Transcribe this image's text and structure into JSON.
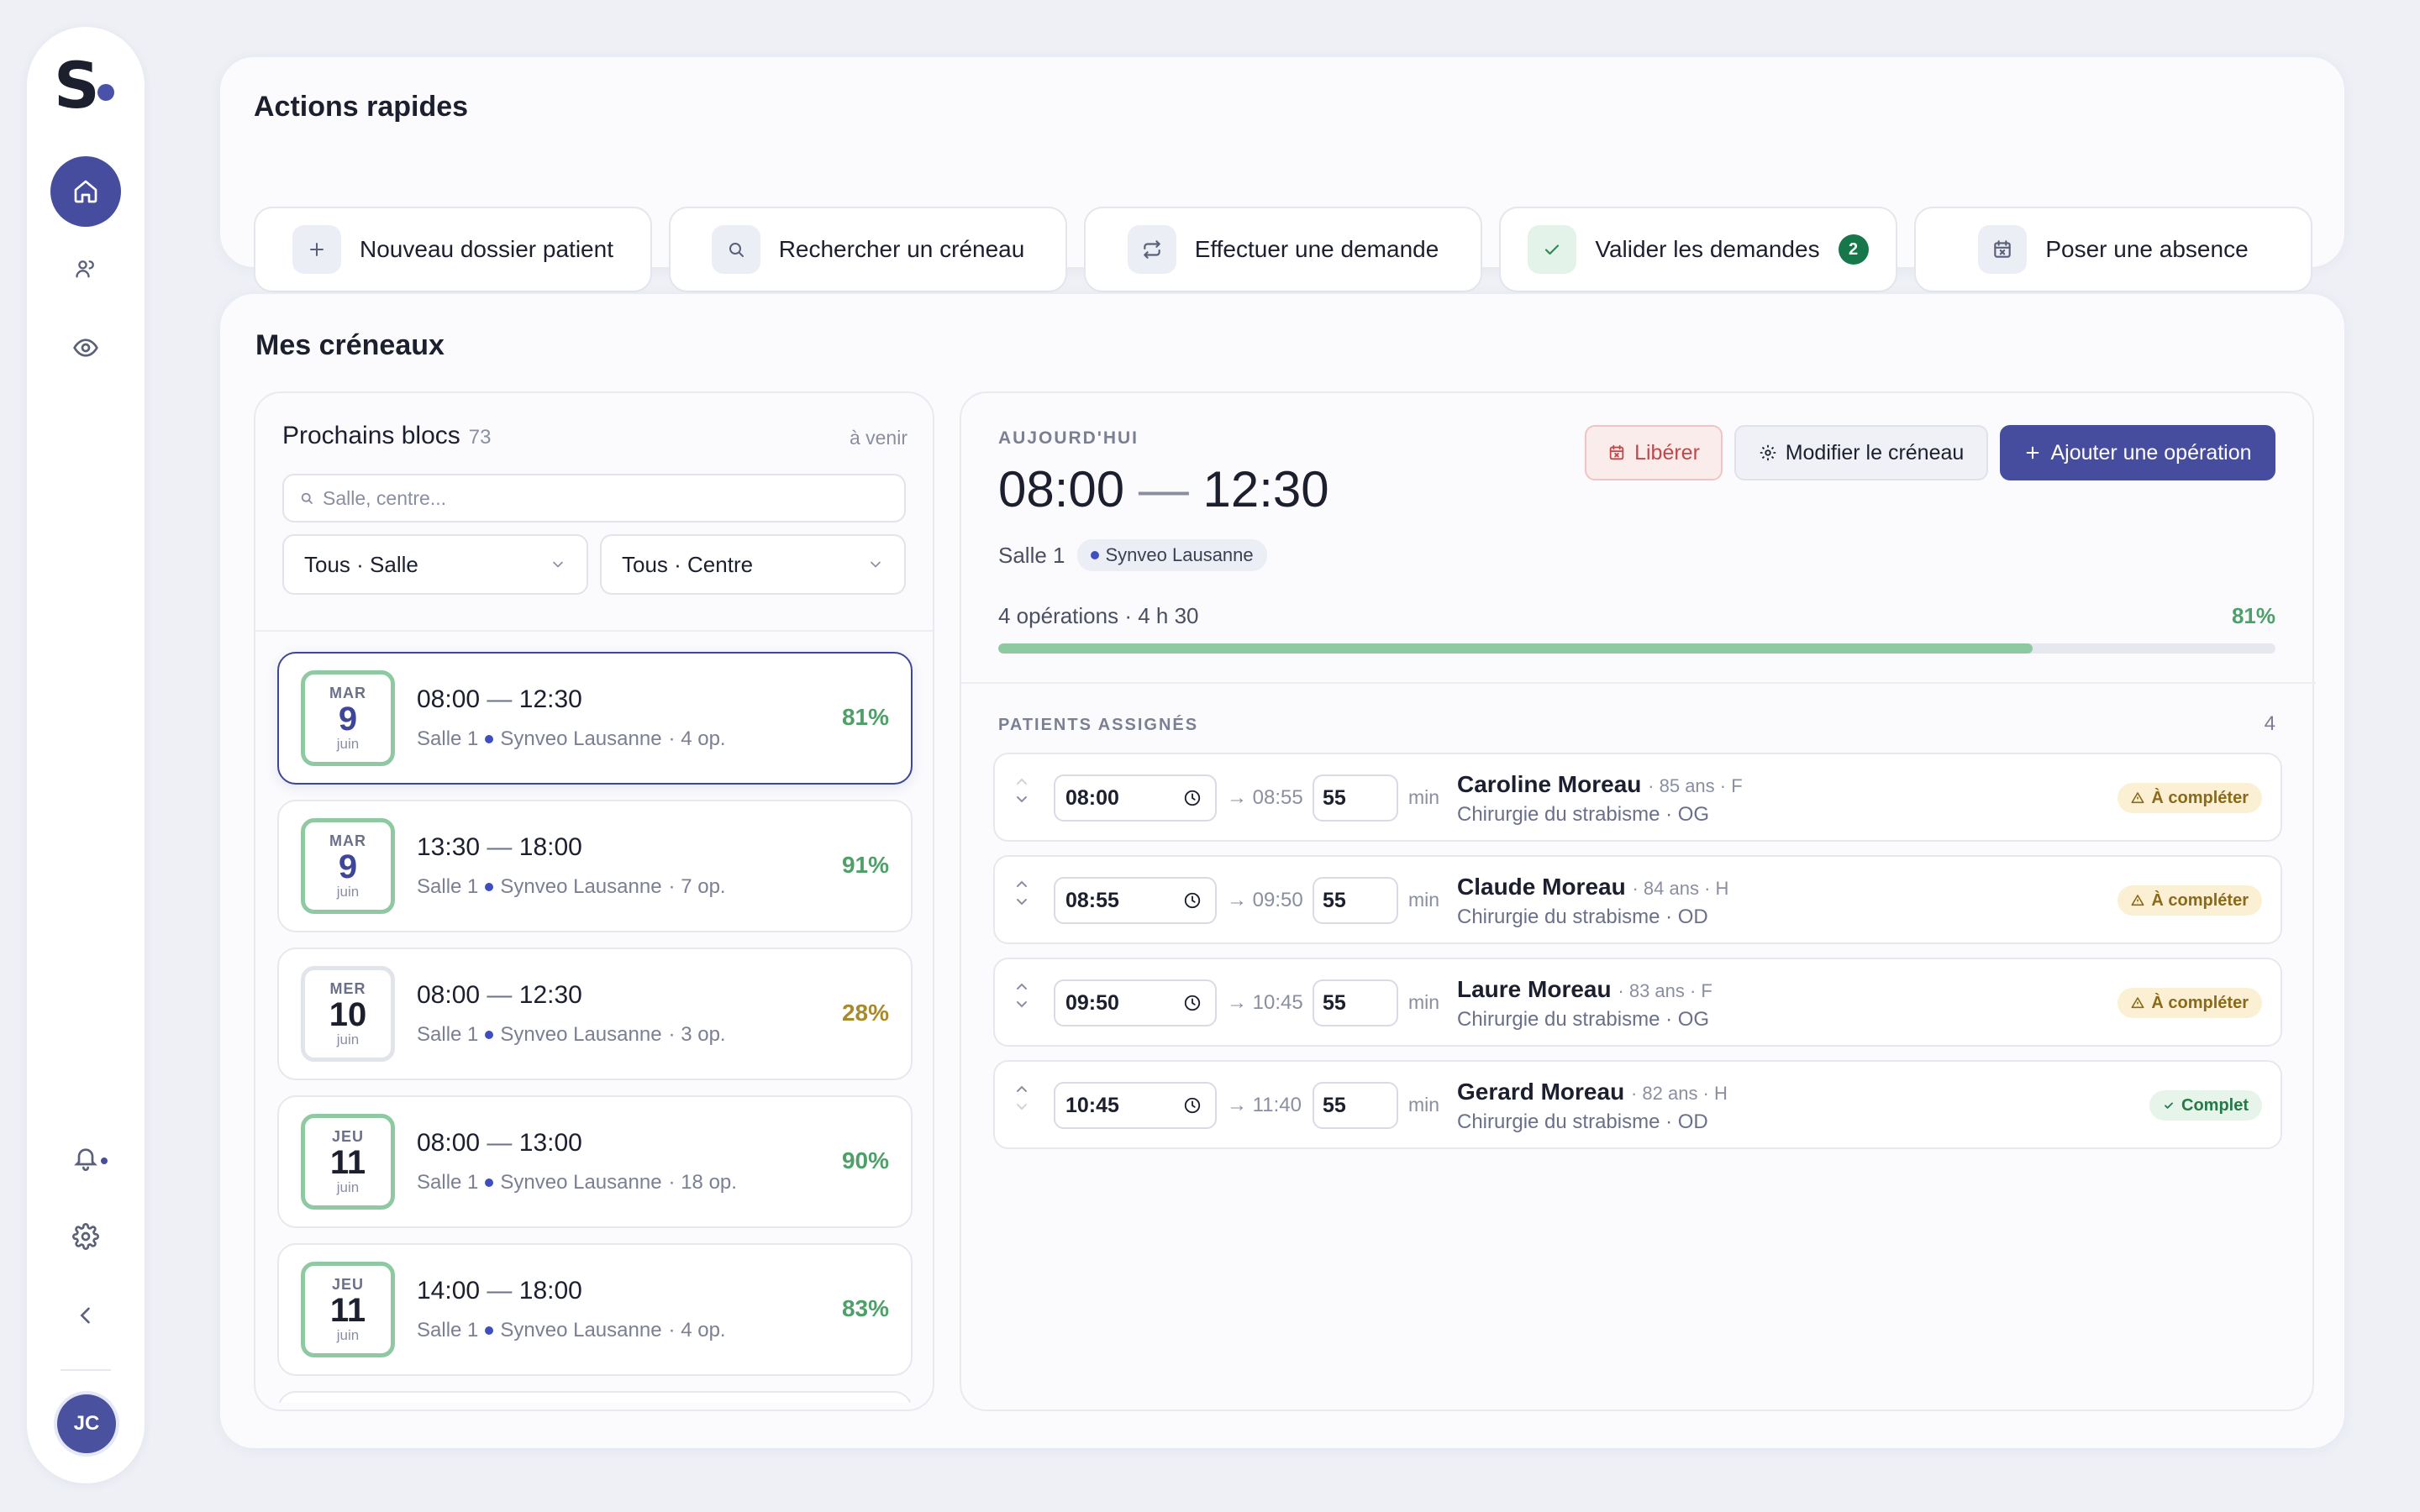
{
  "sidebar": {
    "logo": "S",
    "user_initials": "JC"
  },
  "quick_actions": {
    "title": "Actions rapides",
    "items": [
      {
        "label": "Nouveau dossier patient",
        "icon": "plus-icon"
      },
      {
        "label": "Rechercher un créneau",
        "icon": "search-icon"
      },
      {
        "label": "Effectuer une demande",
        "icon": "swap-icon"
      },
      {
        "label": "Valider les demandes",
        "icon": "check-icon",
        "badge": "2"
      },
      {
        "label": "Poser une absence",
        "icon": "calendar-x-icon"
      }
    ]
  },
  "creneaux": {
    "title": "Mes créneaux",
    "list": {
      "title": "Prochains blocs",
      "count": "73",
      "filter_label": "à venir",
      "search_placeholder": "Salle, centre...",
      "select_salle": "Tous · Salle",
      "select_centre": "Tous · Centre",
      "slots": [
        {
          "day": "MAR",
          "num": "9",
          "month": "juin",
          "start": "08:00",
          "end": "12:30",
          "room": "Salle 1",
          "center": "Synveo Lausanne",
          "ops": "· 4 op.",
          "pct": "81%"
        },
        {
          "day": "MAR",
          "num": "9",
          "month": "juin",
          "start": "13:30",
          "end": "18:00",
          "room": "Salle 1",
          "center": "Synveo Lausanne",
          "ops": "· 7 op.",
          "pct": "91%"
        },
        {
          "day": "MER",
          "num": "10",
          "month": "juin",
          "start": "08:00",
          "end": "12:30",
          "room": "Salle 1",
          "center": "Synveo Lausanne",
          "ops": "· 3 op.",
          "pct": "28%"
        },
        {
          "day": "JEU",
          "num": "11",
          "month": "juin",
          "start": "08:00",
          "end": "13:00",
          "room": "Salle 1",
          "center": "Synveo Lausanne",
          "ops": "· 18 op.",
          "pct": "90%"
        },
        {
          "day": "JEU",
          "num": "11",
          "month": "juin",
          "start": "14:00",
          "end": "18:00",
          "room": "Salle 1",
          "center": "Synveo Lausanne",
          "ops": "· 4 op.",
          "pct": "83%"
        }
      ]
    },
    "detail": {
      "label": "AUJOURD'HUI",
      "start": "08:00",
      "end": "12:30",
      "room": "Salle 1",
      "center": "Synveo Lausanne",
      "btn_liberer": "Libérer",
      "btn_modifier": "Modifier le créneau",
      "btn_ajouter": "Ajouter une opération",
      "stats": "4 opérations · 4 h 30",
      "pct": "81%",
      "fill": 0.81,
      "patients_label": "PATIENTS ASSIGNÉS",
      "patients_count": "4",
      "min_label": "min",
      "patients": [
        {
          "start": "08:00",
          "end": "→ 08:55",
          "dur": "55",
          "name": "Caroline Moreau",
          "meta": "· 85 ans · F",
          "proc": "Chirurgie du strabisme · OG",
          "status": "À compléter",
          "ok": false
        },
        {
          "start": "08:55",
          "end": "→ 09:50",
          "dur": "55",
          "name": "Claude Moreau",
          "meta": "· 84 ans · H",
          "proc": "Chirurgie du strabisme · OD",
          "status": "À compléter",
          "ok": false
        },
        {
          "start": "09:50",
          "end": "→ 10:45",
          "dur": "55",
          "name": "Laure Moreau",
          "meta": "· 83 ans · F",
          "proc": "Chirurgie du strabisme · OG",
          "status": "À compléter",
          "ok": false
        },
        {
          "start": "10:45",
          "end": "→ 11:40",
          "dur": "55",
          "name": "Gerard Moreau",
          "meta": "· 82 ans · H",
          "proc": "Chirurgie du strabisme · OD",
          "status": "Complet",
          "ok": true
        }
      ]
    }
  },
  "colors": {
    "accent": "#464d9e",
    "success": "#4f9f6a",
    "warning": "#a88a2c"
  }
}
